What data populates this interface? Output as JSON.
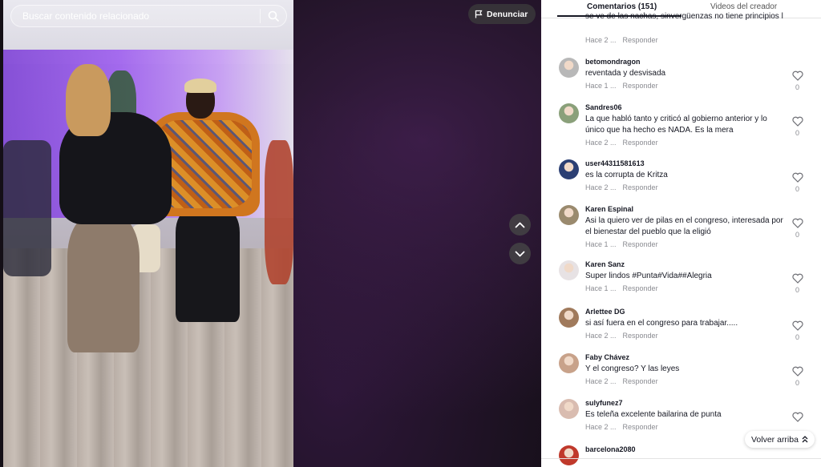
{
  "search": {
    "placeholder": "Buscar contenido relacionado"
  },
  "report": {
    "label": "Denunciar",
    "icon": "flag-icon"
  },
  "video_nav": {
    "prev_icon": "chevron-up-icon",
    "next_icon": "chevron-down-icon"
  },
  "tabs": {
    "comments": "Comentarios (151)",
    "creator": "Videos del creador"
  },
  "reply_label": "Responder",
  "comments": [
    {
      "user": "",
      "text": "se ve de las nachas, sinvergüenzas no tiene principios l",
      "time": "Hace 2 ...",
      "likes": "",
      "avatar_color": "#7a7a7a"
    },
    {
      "user": "betomondragon",
      "text": "reventada y desvisada",
      "time": "Hace 1 ...",
      "likes": "0",
      "avatar_color": "#b8b8b8"
    },
    {
      "user": "Sandres06",
      "text": "La que habló tanto y criticó al gobierno anterior y lo único que ha hecho es NADA. Es la mera ",
      "time": "Hace 2 ...",
      "likes": "0",
      "avatar_color": "#8aa07a"
    },
    {
      "user": "user44311581613",
      "text": "es la corrupta de Kritza",
      "time": "Hace 2 ...",
      "likes": "0",
      "avatar_color": "#2b3f73"
    },
    {
      "user": "Karen Espinal",
      "text": "Asi la quiero ver de pilas en el congreso, interesada por el bienestar del pueblo que la eligió",
      "time": "Hace 1 ...",
      "likes": "0",
      "avatar_color": "#9a8a6e"
    },
    {
      "user": "Karen Sanz ",
      "text": "Super lindos #Punta#Vida##Alegria",
      "time": "Hace 1 ...",
      "likes": "0",
      "avatar_color": "#e7e2e4"
    },
    {
      "user": "Arlettee DG",
      "text": "si así fuera en el congreso para trabajar.....",
      "time": "Hace 2 ...",
      "likes": "0",
      "avatar_color": "#a07a5c"
    },
    {
      "user": "Faby Chávez",
      "text": "Y el congreso? Y las leyes",
      "time": "Hace 2 ...",
      "likes": "0",
      "avatar_color": "#c8a28a"
    },
    {
      "user": "sulyfunez7",
      "text": "Es teleña excelente bailarina de punta",
      "time": "Hace 2 ...",
      "likes": "",
      "avatar_color": "#d9bcb0"
    },
    {
      "user": "barcelona2080",
      "text": "",
      "time": "",
      "likes": "",
      "avatar_color": "#c0392b"
    }
  ],
  "back_to_top": "Volver arriba",
  "colors": {
    "accent": "#161823",
    "muted": "#8a8b91"
  }
}
